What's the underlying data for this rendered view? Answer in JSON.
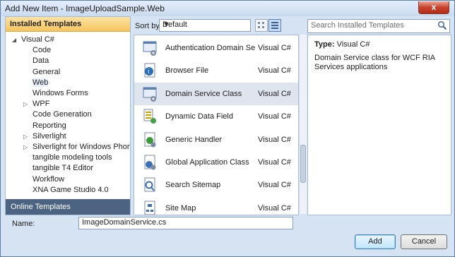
{
  "window": {
    "title": "Add New Item - ImageUploadSample.Web",
    "close_label": "x"
  },
  "left": {
    "header": "Installed Templates",
    "tree": [
      {
        "label": "Visual C#",
        "expander": "expanded",
        "indent": 0
      },
      {
        "label": "Code",
        "indent": 1
      },
      {
        "label": "Data",
        "indent": 1
      },
      {
        "label": "General",
        "indent": 1
      },
      {
        "label": "Web",
        "indent": 1,
        "selected": true
      },
      {
        "label": "Windows Forms",
        "indent": 1
      },
      {
        "label": "WPF",
        "expander": "collapsed",
        "indent": 1
      },
      {
        "label": "Code Generation",
        "indent": 1
      },
      {
        "label": "Reporting",
        "indent": 1
      },
      {
        "label": "Silverlight",
        "expander": "collapsed",
        "indent": 1
      },
      {
        "label": "Silverlight for Windows Phone",
        "expander": "collapsed",
        "indent": 1
      },
      {
        "label": "tangible modeling tools",
        "indent": 1
      },
      {
        "label": "tangible T4 Editor",
        "indent": 1
      },
      {
        "label": "Workflow",
        "indent": 1
      },
      {
        "label": "XNA Game Studio 4.0",
        "indent": 1
      }
    ],
    "online": "Online Templates"
  },
  "center": {
    "sort_label": "Sort by:",
    "sort_value": "Default",
    "items": [
      {
        "name": "Authentication Domain Servi...",
        "type": "Visual C#",
        "icon": "domain-service-icon"
      },
      {
        "name": "Browser File",
        "type": "Visual C#",
        "icon": "browser-file-icon"
      },
      {
        "name": "Domain Service Class",
        "type": "Visual C#",
        "icon": "domain-service-icon",
        "selected": true
      },
      {
        "name": "Dynamic Data Field",
        "type": "Visual C#",
        "icon": "dynamic-data-icon"
      },
      {
        "name": "Generic Handler",
        "type": "Visual C#",
        "icon": "generic-handler-icon"
      },
      {
        "name": "Global Application Class",
        "type": "Visual C#",
        "icon": "global-app-icon"
      },
      {
        "name": "Search Sitemap",
        "type": "Visual C#",
        "icon": "search-sitemap-icon"
      },
      {
        "name": "Site Map",
        "type": "Visual C#",
        "icon": "site-map-icon"
      }
    ]
  },
  "right": {
    "search_placeholder": "Search Installed Templates",
    "type_label": "Type:",
    "type_value": "Visual C#",
    "description": "Domain Service class for WCF RIA Services applications"
  },
  "bottom": {
    "name_label": "Name:",
    "name_value": "ImageDomainService.cs",
    "add_label": "Add",
    "cancel_label": "Cancel"
  }
}
